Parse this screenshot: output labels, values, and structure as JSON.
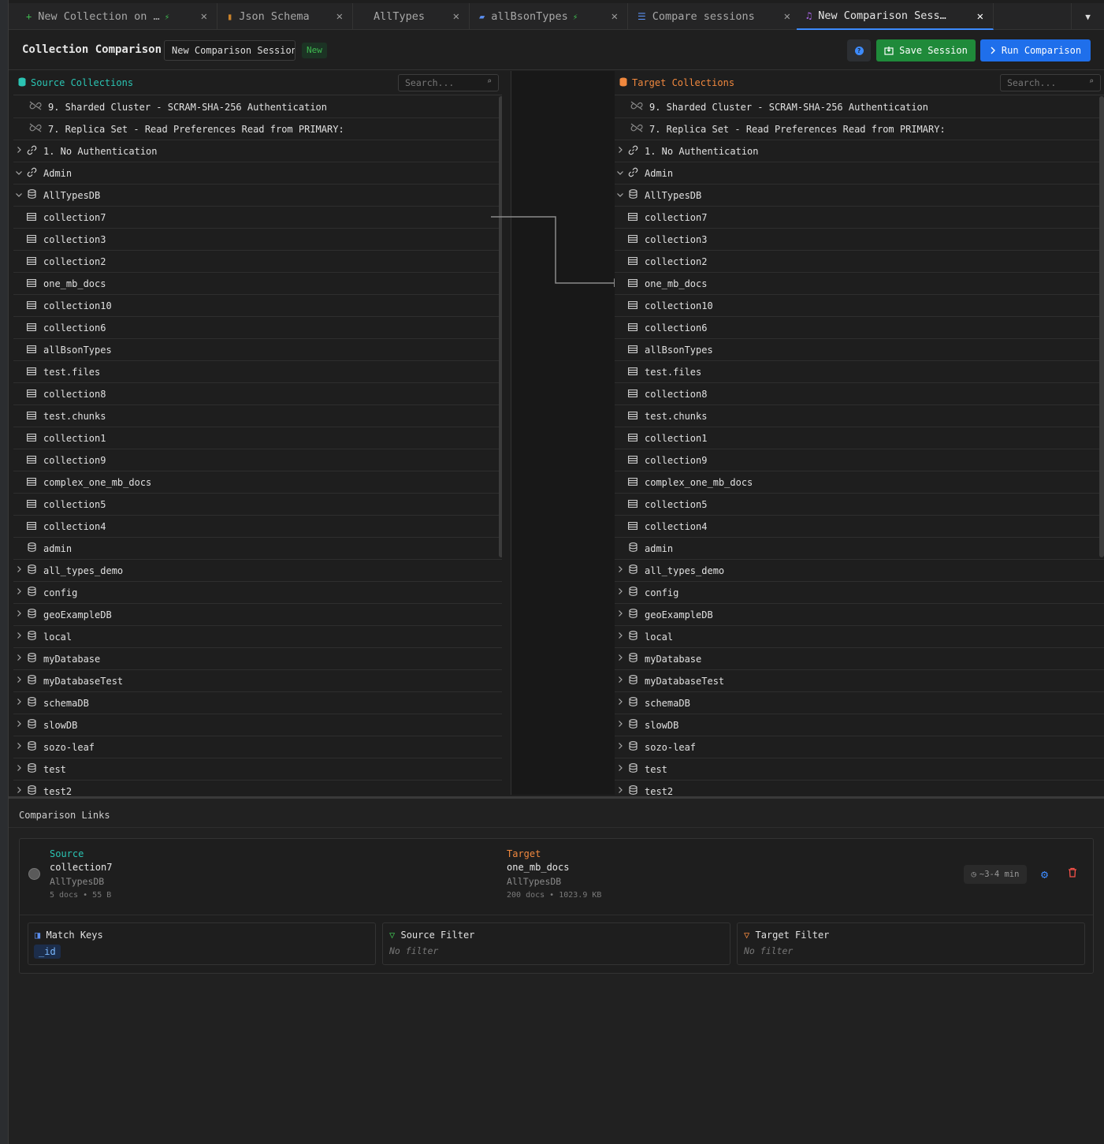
{
  "tabs": [
    {
      "label": "New Collection on …",
      "icon": "+",
      "icon_color": "#3fb950",
      "plug": true
    },
    {
      "label": "Json Schema",
      "icon": "▮",
      "icon_color": "#c9822a",
      "plug": false
    },
    {
      "label": "AllTypes",
      "icon": "",
      "icon_color": "#888",
      "plug": false
    },
    {
      "label": "allBsonTypes",
      "icon": "▰",
      "icon_color": "#5b8ff0",
      "plug": true
    },
    {
      "label": "Compare sessions",
      "icon": "☰",
      "icon_color": "#5b8ff0",
      "plug": false
    },
    {
      "label": "New Comparison Sess…",
      "icon": "♫",
      "icon_color": "#b36af5",
      "plug": false
    }
  ],
  "tab_close": "✕",
  "header": {
    "title": "Collection Comparison",
    "session_name": "New Comparison Session",
    "badge": "New",
    "save_label": "Save Session",
    "run_label": "Run Comparison",
    "help": "?"
  },
  "source": {
    "title": "Source Collections",
    "search_placeholder": "Search..."
  },
  "target": {
    "title": "Target Collections",
    "search_placeholder": "Search..."
  },
  "tree": [
    {
      "lvl": 0,
      "chev": "",
      "icon": "off",
      "label": "9. Sharded Cluster - SCRAM-SHA-256 Authentication"
    },
    {
      "lvl": 0,
      "chev": "",
      "icon": "off",
      "label": "7. Replica Set - Read Preferences Read from PRIMARY:"
    },
    {
      "lvl": 0,
      "chev": ">",
      "icon": "link",
      "label": "1. No Authentication"
    },
    {
      "lvl": 0,
      "chev": "v",
      "icon": "link",
      "label": "Admin"
    },
    {
      "lvl": 1,
      "chev": "v",
      "icon": "db",
      "label": "AllTypesDB"
    },
    {
      "lvl": 2,
      "chev": "",
      "icon": "coll",
      "label": "collection7"
    },
    {
      "lvl": 2,
      "chev": "",
      "icon": "coll",
      "label": "collection3"
    },
    {
      "lvl": 2,
      "chev": "",
      "icon": "coll",
      "label": "collection2"
    },
    {
      "lvl": 2,
      "chev": "",
      "icon": "coll",
      "label": "one_mb_docs"
    },
    {
      "lvl": 2,
      "chev": "",
      "icon": "coll",
      "label": "collection10"
    },
    {
      "lvl": 2,
      "chev": "",
      "icon": "coll",
      "label": "collection6"
    },
    {
      "lvl": 2,
      "chev": "",
      "icon": "coll",
      "label": "allBsonTypes"
    },
    {
      "lvl": 2,
      "chev": "",
      "icon": "coll",
      "label": "test.files"
    },
    {
      "lvl": 2,
      "chev": "",
      "icon": "coll",
      "label": "collection8"
    },
    {
      "lvl": 2,
      "chev": "",
      "icon": "coll",
      "label": "test.chunks"
    },
    {
      "lvl": 2,
      "chev": "",
      "icon": "coll",
      "label": "collection1"
    },
    {
      "lvl": 2,
      "chev": "",
      "icon": "coll",
      "label": "collection9"
    },
    {
      "lvl": 2,
      "chev": "",
      "icon": "coll",
      "label": "complex_one_mb_docs"
    },
    {
      "lvl": 2,
      "chev": "",
      "icon": "coll",
      "label": "collection5"
    },
    {
      "lvl": 2,
      "chev": "",
      "icon": "coll",
      "label": "collection4"
    },
    {
      "lvl": 1,
      "chev": "",
      "icon": "db",
      "label": "admin"
    },
    {
      "lvl": 1,
      "chev": ">",
      "icon": "db",
      "label": "all_types_demo"
    },
    {
      "lvl": 1,
      "chev": ">",
      "icon": "db",
      "label": "config"
    },
    {
      "lvl": 1,
      "chev": ">",
      "icon": "db",
      "label": "geoExampleDB"
    },
    {
      "lvl": 1,
      "chev": ">",
      "icon": "db",
      "label": "local"
    },
    {
      "lvl": 1,
      "chev": ">",
      "icon": "db",
      "label": "myDatabase"
    },
    {
      "lvl": 1,
      "chev": ">",
      "icon": "db",
      "label": "myDatabaseTest"
    },
    {
      "lvl": 1,
      "chev": ">",
      "icon": "db",
      "label": "schemaDB"
    },
    {
      "lvl": 1,
      "chev": ">",
      "icon": "db",
      "label": "slowDB"
    },
    {
      "lvl": 1,
      "chev": ">",
      "icon": "db",
      "label": "sozo-leaf"
    },
    {
      "lvl": 1,
      "chev": ">",
      "icon": "db",
      "label": "test"
    },
    {
      "lvl": 1,
      "chev": ">",
      "icon": "db",
      "label": "test2"
    }
  ],
  "links": {
    "title": "Comparison Links",
    "source_label": "Source",
    "source_coll": "collection7",
    "source_db": "AllTypesDB",
    "source_meta": "5 docs • 55 B",
    "target_label": "Target",
    "target_coll": "one_mb_docs",
    "target_db": "AllTypesDB",
    "target_meta": "200 docs • 1023.9 KB",
    "eta": "~3-4 min",
    "match_keys_title": "Match Keys",
    "match_key": "_id",
    "source_filter_title": "Source Filter",
    "source_filter": "No filter",
    "target_filter_title": "Target Filter",
    "target_filter": "No filter"
  },
  "colors": {
    "source": "#2bc4b3",
    "target": "#f0883e",
    "save": "#1f8a3a",
    "run": "#1f6feb"
  }
}
